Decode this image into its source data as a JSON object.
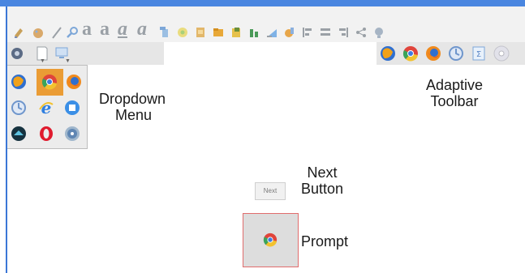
{
  "labels": {
    "dropdown_menu": [
      "Dropdown",
      "Menu"
    ],
    "adaptive_toolbar": [
      "Adaptive",
      "Toolbar"
    ],
    "next_button": [
      "Next",
      "Button"
    ],
    "prompt": "Prompt"
  },
  "next_button_text": "Next",
  "toolbar_glyphs": [
    "a",
    "a",
    "a",
    "a"
  ],
  "colors": {
    "top_bar": "#4a86e0",
    "prompt_border": "#e06d6d",
    "dropdown_selected": "#ea9c35"
  },
  "icons": {
    "toolbar_row1": [
      "edit-icon",
      "paint-icon",
      "line-icon",
      "zoom-icon",
      "font-bold-icon",
      "font-serif-icon",
      "font-underline-icon",
      "font-italic-icon",
      "paste-icon",
      "color-picker-icon",
      "print-icon",
      "folder-icon",
      "save-icon",
      "chart-icon",
      "brush-icon",
      "align-left-icon",
      "align-center-icon",
      "align-right-icon",
      "share-icon",
      "bulb-icon"
    ],
    "toolbar_row2_left": [
      "settings-icon",
      "document-icon",
      "monitor-icon"
    ],
    "adaptive_toolbar": [
      "firefox-icon",
      "chrome-icon",
      "firefox-alt-icon",
      "update-icon",
      "spreadsheet-icon",
      "disc-icon"
    ],
    "dropdown_grid": [
      "firefox-icon",
      "chrome-icon",
      "firefox-alt-icon",
      "update-icon",
      "ie-icon",
      "media-player-icon",
      "thunderbird-icon",
      "opera-icon",
      "safari-icon"
    ],
    "prompt": "chrome-icon"
  }
}
